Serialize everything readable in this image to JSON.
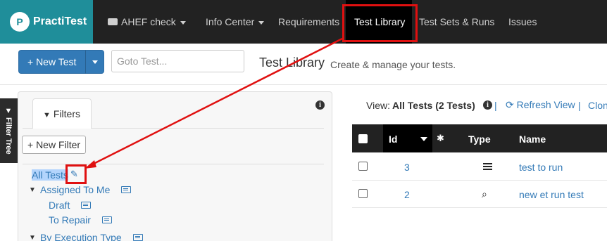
{
  "app": {
    "logo_mark": "P",
    "logo_text": "PractiTest"
  },
  "nav": {
    "project": "AHEF check",
    "info_center": "Info Center",
    "requirements": "Requirements",
    "test_library": "Test Library",
    "test_sets": "Test Sets & Runs",
    "issues": "Issues"
  },
  "toolbar": {
    "new_test_label": "+ New Test",
    "goto_placeholder": "Goto Test...",
    "page_title": "Test Library",
    "page_subtitle": "Create & manage your tests."
  },
  "sidebar_tab": {
    "label": "▼ Filter Tree"
  },
  "filters": {
    "tab_label": "Filters",
    "new_filter_label": "+ New Filter",
    "tree": [
      {
        "label": "All Tests",
        "selected": true
      },
      {
        "label": "Assigned To Me",
        "expanded": true
      },
      {
        "label": "Draft"
      },
      {
        "label": "To Repair"
      },
      {
        "label": "By Execution Type",
        "expanded": true
      }
    ]
  },
  "view": {
    "label": "View:",
    "value": "All Tests (2 Tests)",
    "sep": "|",
    "refresh_label": "Refresh View",
    "clone_label": "Clon"
  },
  "table": {
    "headers": {
      "id": "Id",
      "type": "Type",
      "name": "Name"
    },
    "rows": [
      {
        "id": "3",
        "type_icon": "list-icon",
        "name": "test to run"
      },
      {
        "id": "2",
        "type_icon": "exploratory-icon",
        "name": "new et run test"
      }
    ]
  },
  "annotation": {
    "color": "#e01010"
  }
}
